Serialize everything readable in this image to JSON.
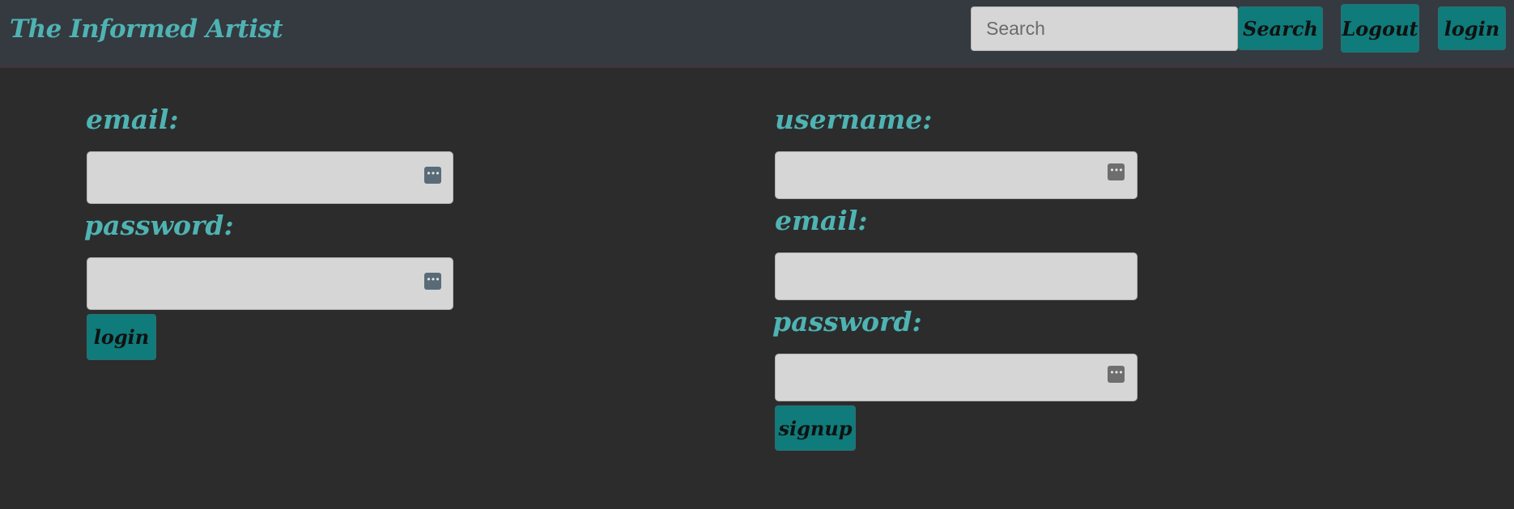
{
  "navbar": {
    "brand": "The Informed Artist",
    "search": {
      "placeholder": "Search",
      "value": ""
    },
    "search_button": "Search",
    "logout_button": "Logout",
    "login_button": "login"
  },
  "login_form": {
    "email_label": "email:",
    "password_label": "password:",
    "submit_label": "login"
  },
  "signup_form": {
    "username_label": "username:",
    "email_label": "email:",
    "password_label": "password:",
    "submit_label": "signup"
  },
  "icons": {
    "password_manager": "password-manager-icon"
  },
  "colors": {
    "accent": "#4fb3b3",
    "button": "#0f7b7b",
    "navbar": "#343a40",
    "background": "#2c2c2c",
    "field": "#d6d6d6"
  }
}
